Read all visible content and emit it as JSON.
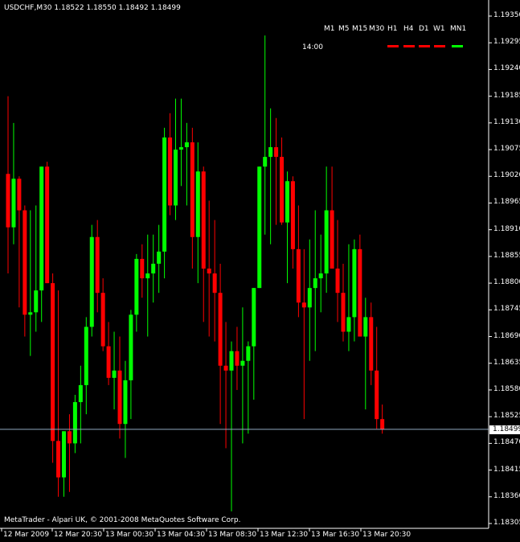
{
  "header": {
    "symbol_title": "USDCHF,M30  1.18522 1.18550 1.18492 1.18499",
    "hour": "14:00",
    "copyright": "MetaTrader - Alpari UK, © 2001-2008 MetaQuotes Software Corp."
  },
  "timeframes": [
    "M1",
    "M5",
    "M15",
    "M30",
    "H1",
    "H4",
    "D1",
    "W1",
    "MN1"
  ],
  "timeframe_colors": [
    "#ff0000",
    "#ff0000",
    "#ff0000",
    "#ff0000",
    "#00ff00",
    "#00ff00"
  ],
  "price_axis": [
    "1.19350",
    "1.19295",
    "1.19240",
    "1.19185",
    "1.19130",
    "1.19075",
    "1.19020",
    "1.18965",
    "1.18910",
    "1.18855",
    "1.18800",
    "1.18745",
    "1.18690",
    "1.18635",
    "1.18580",
    "1.18525",
    "1.18470",
    "1.18415",
    "1.18360",
    "1.18305"
  ],
  "current_price": "1.18499",
  "time_axis": [
    "12 Mar 2009",
    "12 Mar 20:30",
    "13 Mar 00:30",
    "13 Mar 04:30",
    "13 Mar 08:30",
    "13 Mar 12:30",
    "13 Mar 16:30",
    "13 Mar 20:30"
  ],
  "colors": {
    "up": "#00ff00",
    "down": "#ff0000",
    "background": "#000000",
    "axis": "#ffffff",
    "price_line": "#8fa9c0"
  },
  "chart_data": {
    "type": "candlestick",
    "symbol": "USDCHF",
    "timeframe": "M30",
    "ylim": [
      1.18305,
      1.1935
    ],
    "candles": [
      {
        "o": 1.19025,
        "h": 1.19185,
        "l": 1.1882,
        "c": 1.18915
      },
      {
        "o": 1.18915,
        "h": 1.1913,
        "l": 1.1888,
        "c": 1.19015
      },
      {
        "o": 1.19015,
        "h": 1.1902,
        "l": 1.1875,
        "c": 1.1895
      },
      {
        "o": 1.1895,
        "h": 1.1896,
        "l": 1.1869,
        "c": 1.18735
      },
      {
        "o": 1.18735,
        "h": 1.1895,
        "l": 1.1865,
        "c": 1.1874
      },
      {
        "o": 1.1874,
        "h": 1.1896,
        "l": 1.187,
        "c": 1.18785
      },
      {
        "o": 1.18785,
        "h": 1.1904,
        "l": 1.1872,
        "c": 1.1904
      },
      {
        "o": 1.1904,
        "h": 1.1905,
        "l": 1.188,
        "c": 1.188
      },
      {
        "o": 1.188,
        "h": 1.1882,
        "l": 1.1843,
        "c": 1.18475
      },
      {
        "o": 1.18475,
        "h": 1.18785,
        "l": 1.1836,
        "c": 1.184
      },
      {
        "o": 1.184,
        "h": 1.18495,
        "l": 1.1836,
        "c": 1.18495
      },
      {
        "o": 1.18495,
        "h": 1.1853,
        "l": 1.1837,
        "c": 1.1847
      },
      {
        "o": 1.1847,
        "h": 1.1857,
        "l": 1.1845,
        "c": 1.18555
      },
      {
        "o": 1.18555,
        "h": 1.1863,
        "l": 1.1847,
        "c": 1.1859
      },
      {
        "o": 1.1859,
        "h": 1.1873,
        "l": 1.1853,
        "c": 1.1871
      },
      {
        "o": 1.1871,
        "h": 1.1892,
        "l": 1.1869,
        "c": 1.18895
      },
      {
        "o": 1.18895,
        "h": 1.1893,
        "l": 1.1874,
        "c": 1.1878
      },
      {
        "o": 1.1878,
        "h": 1.1881,
        "l": 1.1866,
        "c": 1.1867
      },
      {
        "o": 1.1867,
        "h": 1.1872,
        "l": 1.1859,
        "c": 1.18605
      },
      {
        "o": 1.18605,
        "h": 1.187,
        "l": 1.1854,
        "c": 1.1862
      },
      {
        "o": 1.1862,
        "h": 1.1869,
        "l": 1.1848,
        "c": 1.1851
      },
      {
        "o": 1.1851,
        "h": 1.1864,
        "l": 1.1844,
        "c": 1.186
      },
      {
        "o": 1.186,
        "h": 1.18745,
        "l": 1.1852,
        "c": 1.18735
      },
      {
        "o": 1.18735,
        "h": 1.1886,
        "l": 1.187,
        "c": 1.1885
      },
      {
        "o": 1.1885,
        "h": 1.1888,
        "l": 1.1877,
        "c": 1.1881
      },
      {
        "o": 1.1881,
        "h": 1.189,
        "l": 1.1869,
        "c": 1.1882
      },
      {
        "o": 1.1882,
        "h": 1.189,
        "l": 1.1876,
        "c": 1.1884
      },
      {
        "o": 1.1884,
        "h": 1.1892,
        "l": 1.1878,
        "c": 1.18865
      },
      {
        "o": 1.18865,
        "h": 1.1912,
        "l": 1.1881,
        "c": 1.191
      },
      {
        "o": 1.191,
        "h": 1.1915,
        "l": 1.1894,
        "c": 1.1896
      },
      {
        "o": 1.1896,
        "h": 1.1918,
        "l": 1.1893,
        "c": 1.19075
      },
      {
        "o": 1.19075,
        "h": 1.1918,
        "l": 1.19,
        "c": 1.1908
      },
      {
        "o": 1.1908,
        "h": 1.1913,
        "l": 1.1896,
        "c": 1.1909
      },
      {
        "o": 1.1909,
        "h": 1.1912,
        "l": 1.1883,
        "c": 1.18895
      },
      {
        "o": 1.18895,
        "h": 1.1909,
        "l": 1.188,
        "c": 1.1903
      },
      {
        "o": 1.1903,
        "h": 1.1904,
        "l": 1.1872,
        "c": 1.1883
      },
      {
        "o": 1.1883,
        "h": 1.1897,
        "l": 1.1869,
        "c": 1.1882
      },
      {
        "o": 1.1882,
        "h": 1.1893,
        "l": 1.1868,
        "c": 1.1878
      },
      {
        "o": 1.1878,
        "h": 1.1884,
        "l": 1.1851,
        "c": 1.1863
      },
      {
        "o": 1.1863,
        "h": 1.1872,
        "l": 1.1846,
        "c": 1.1862
      },
      {
        "o": 1.1862,
        "h": 1.1868,
        "l": 1.1833,
        "c": 1.1866
      },
      {
        "o": 1.1866,
        "h": 1.1871,
        "l": 1.1858,
        "c": 1.1863
      },
      {
        "o": 1.1863,
        "h": 1.1875,
        "l": 1.1847,
        "c": 1.1864
      },
      {
        "o": 1.1864,
        "h": 1.1868,
        "l": 1.1849,
        "c": 1.1867
      },
      {
        "o": 1.1867,
        "h": 1.1879,
        "l": 1.1856,
        "c": 1.1879
      },
      {
        "o": 1.1879,
        "h": 1.1904,
        "l": 1.1879,
        "c": 1.1904
      },
      {
        "o": 1.1904,
        "h": 1.1931,
        "l": 1.189,
        "c": 1.1906
      },
      {
        "o": 1.1906,
        "h": 1.1916,
        "l": 1.1888,
        "c": 1.1908
      },
      {
        "o": 1.1908,
        "h": 1.1914,
        "l": 1.1892,
        "c": 1.1906
      },
      {
        "o": 1.1906,
        "h": 1.191,
        "l": 1.1892,
        "c": 1.18925
      },
      {
        "o": 1.18925,
        "h": 1.1903,
        "l": 1.188,
        "c": 1.1901
      },
      {
        "o": 1.1901,
        "h": 1.1902,
        "l": 1.1883,
        "c": 1.1887
      },
      {
        "o": 1.1887,
        "h": 1.1896,
        "l": 1.1873,
        "c": 1.1876
      },
      {
        "o": 1.1876,
        "h": 1.1887,
        "l": 1.1852,
        "c": 1.1875
      },
      {
        "o": 1.1875,
        "h": 1.1889,
        "l": 1.1864,
        "c": 1.1879
      },
      {
        "o": 1.1879,
        "h": 1.1895,
        "l": 1.1866,
        "c": 1.1881
      },
      {
        "o": 1.1881,
        "h": 1.189,
        "l": 1.1874,
        "c": 1.1882
      },
      {
        "o": 1.1882,
        "h": 1.1904,
        "l": 1.1878,
        "c": 1.1895
      },
      {
        "o": 1.1895,
        "h": 1.1904,
        "l": 1.1884,
        "c": 1.1883
      },
      {
        "o": 1.1883,
        "h": 1.1893,
        "l": 1.1872,
        "c": 1.1878
      },
      {
        "o": 1.1878,
        "h": 1.1884,
        "l": 1.1868,
        "c": 1.187
      },
      {
        "o": 1.187,
        "h": 1.1888,
        "l": 1.1866,
        "c": 1.1873
      },
      {
        "o": 1.1873,
        "h": 1.1889,
        "l": 1.1868,
        "c": 1.1887
      },
      {
        "o": 1.1887,
        "h": 1.189,
        "l": 1.1873,
        "c": 1.1869
      },
      {
        "o": 1.1869,
        "h": 1.1877,
        "l": 1.1854,
        "c": 1.1873
      },
      {
        "o": 1.1873,
        "h": 1.1876,
        "l": 1.1859,
        "c": 1.1862
      },
      {
        "o": 1.1862,
        "h": 1.1871,
        "l": 1.185,
        "c": 1.1852
      },
      {
        "o": 1.1852,
        "h": 1.1855,
        "l": 1.1849,
        "c": 1.18499
      }
    ]
  }
}
